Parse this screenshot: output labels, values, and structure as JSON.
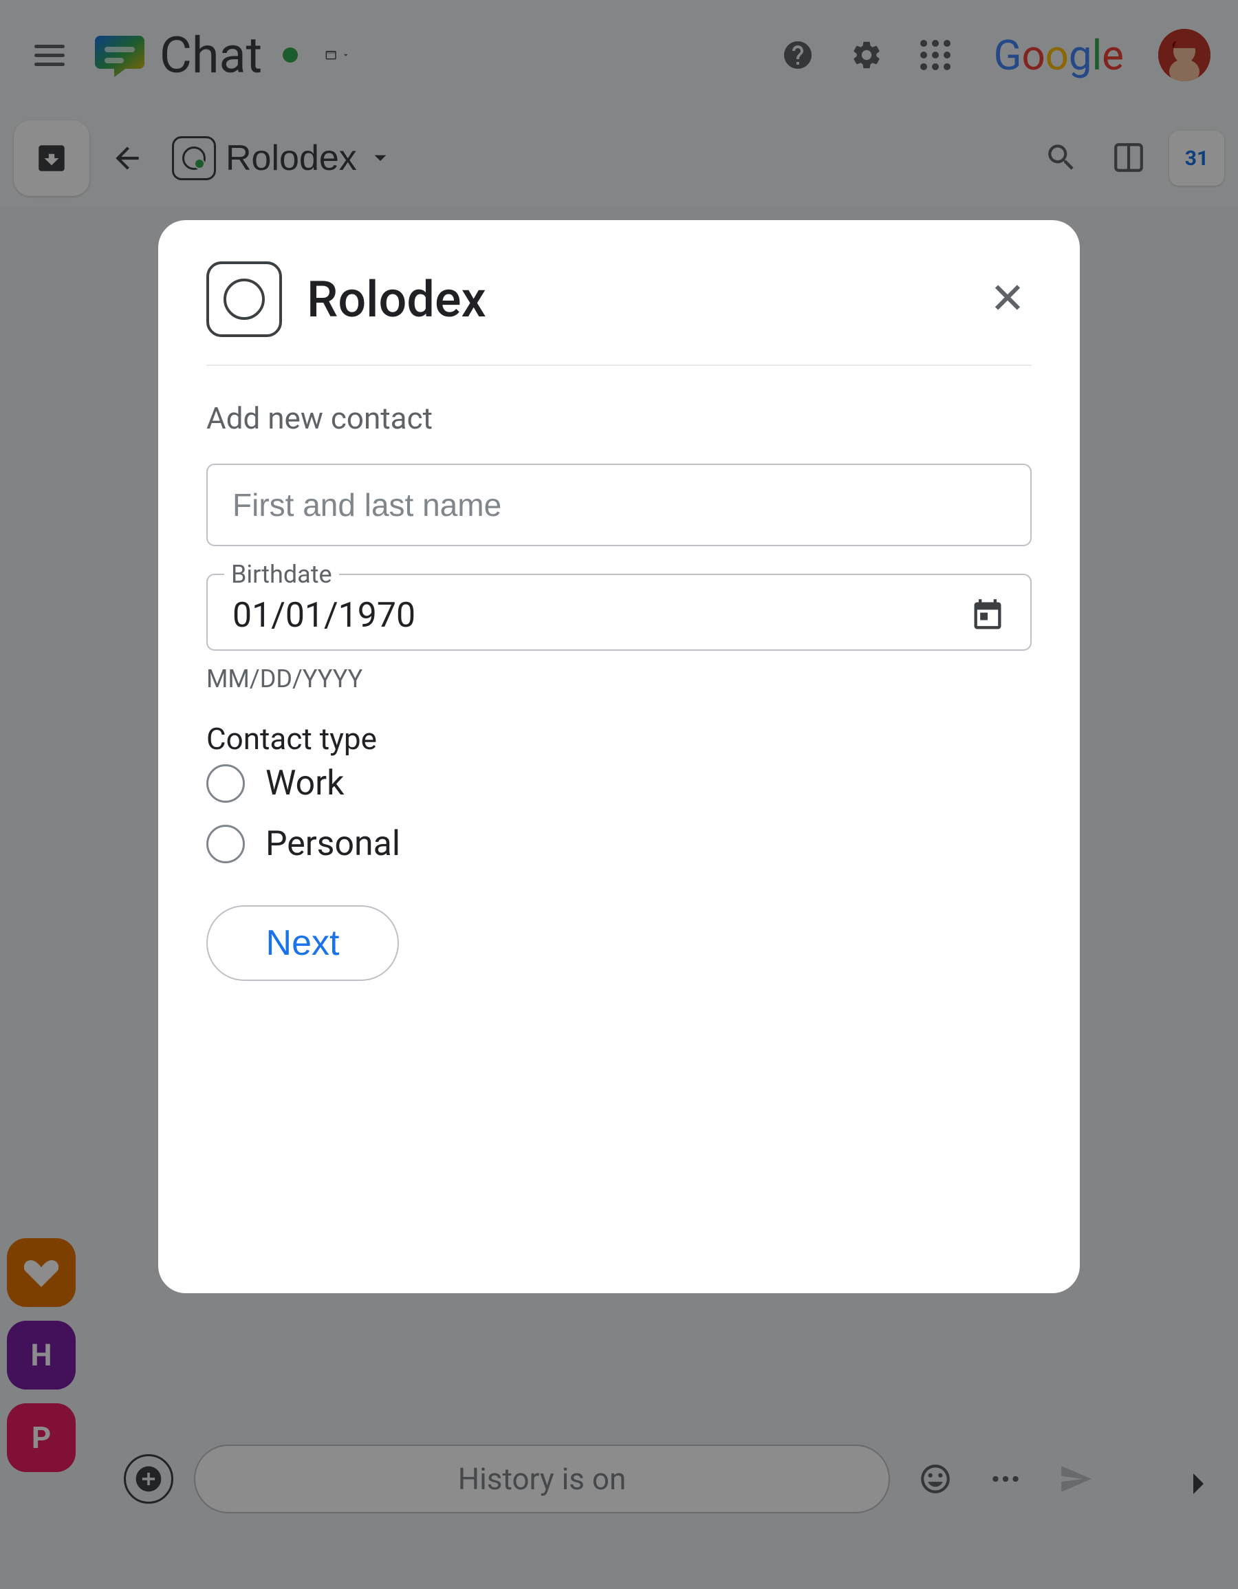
{
  "topNav": {
    "hamburger_label": "menu",
    "app_name": "Chat",
    "status": "online",
    "help_label": "help",
    "settings_label": "settings",
    "apps_label": "apps",
    "google_label": "Google",
    "avatar_label": "user avatar"
  },
  "secondaryBar": {
    "compose_label": "compose",
    "back_label": "back",
    "channel_name": "Rolodex",
    "search_label": "search",
    "split_label": "split view",
    "calendar_badge": "31"
  },
  "modal": {
    "title": "Rolodex",
    "close_label": "close",
    "section_label": "Add new contact",
    "name_placeholder": "First and last name",
    "birthdate_label": "Birthdate",
    "birthdate_value": "01/01/1970",
    "birthdate_hint": "MM/DD/YYYY",
    "contact_type_label": "Contact type",
    "contact_types": [
      {
        "label": "Work",
        "checked": false
      },
      {
        "label": "Personal",
        "checked": false
      }
    ],
    "next_btn_label": "Next"
  },
  "bottomBar": {
    "add_label": "add",
    "input_placeholder": "History is on",
    "emoji_label": "emoji",
    "more_label": "more options",
    "send_label": "send"
  },
  "sidebar": {
    "icons": [
      {
        "label": "heart-icon",
        "color": "#e37400"
      }
    ]
  }
}
